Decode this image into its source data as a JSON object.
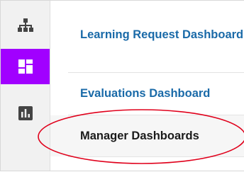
{
  "rail": {
    "items": [
      {
        "icon": "hierarchy-icon",
        "active": false
      },
      {
        "icon": "dashboard-grid-icon",
        "active": true
      },
      {
        "icon": "bar-chart-icon",
        "active": false
      }
    ],
    "active_color": "#a100ff"
  },
  "menu": {
    "items": [
      {
        "label": "Learning Request Dashboard"
      },
      {
        "label": "Evaluations Dashboard"
      },
      {
        "label": "Manager Dashboards"
      }
    ],
    "link_color": "#1a6aa8",
    "highlight_color": "#e0001b"
  }
}
